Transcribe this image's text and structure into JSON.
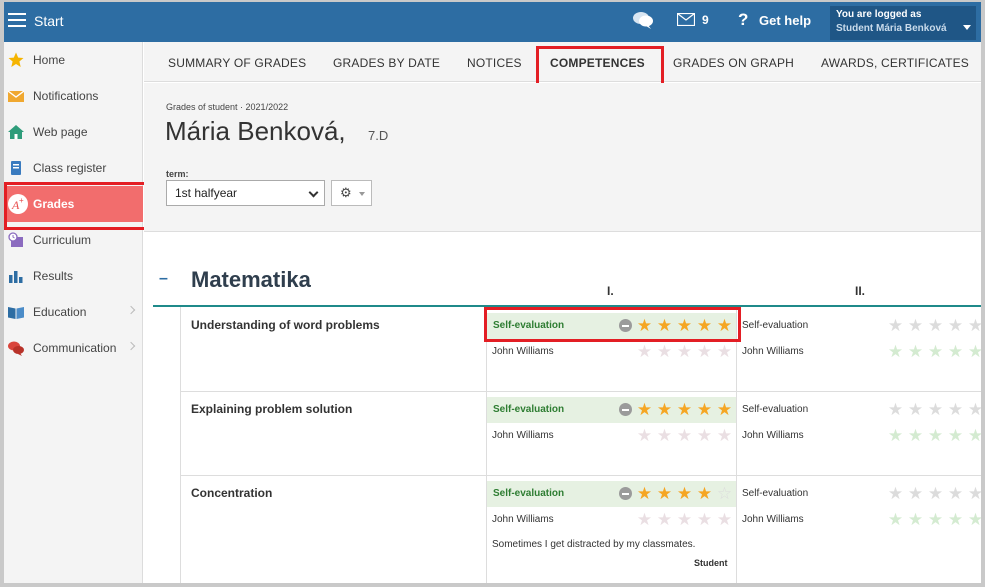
{
  "topbar": {
    "title": "Start",
    "menu_icon": "hamburger-icon",
    "chat_icon": "chat-bubbles-icon",
    "mail_icon": "mail-icon",
    "mail_count": "9",
    "help_icon": "question-icon",
    "help_label": "Get help",
    "logged_label": "You are logged as",
    "logged_user": "Student Mária Benková"
  },
  "sidebar": {
    "items": [
      {
        "label": "Home",
        "icon": "star-icon"
      },
      {
        "label": "Notifications",
        "icon": "envelope-icon"
      },
      {
        "label": "Web page",
        "icon": "house-icon"
      },
      {
        "label": "Class register",
        "icon": "book-icon"
      },
      {
        "label": "Grades",
        "icon": "grade-icon",
        "active": true
      },
      {
        "label": "Curriculum",
        "icon": "curriculum-icon"
      },
      {
        "label": "Results",
        "icon": "bar-chart-icon"
      },
      {
        "label": "Education",
        "icon": "open-book-icon"
      },
      {
        "label": "Communication",
        "icon": "speech-bubbles-icon"
      }
    ]
  },
  "tabs": [
    {
      "label": "SUMMARY OF GRADES"
    },
    {
      "label": "GRADES BY DATE"
    },
    {
      "label": "NOTICES"
    },
    {
      "label": "COMPETENCES",
      "active": true
    },
    {
      "label": "GRADES ON GRAPH"
    },
    {
      "label": "AWARDS, CERTIFICATES"
    }
  ],
  "header": {
    "grades_of": "Grades of student · 2021/2022",
    "student_name": "Mária Benková,",
    "student_class": "7.D",
    "term_label": "term:",
    "term_value": "1st halfyear"
  },
  "subject": {
    "collapse_symbol": "–",
    "name": "Matematika",
    "period_1": "I.",
    "period_2": "II."
  },
  "competences": [
    {
      "name": "Understanding of word problems",
      "self_label": "Self-evaluation",
      "self_stars_p1": 5,
      "teacher": "John Williams",
      "teacher_stars_p1": 0,
      "self_label_p2": "Self-evaluation",
      "teacher_p2": "John Williams"
    },
    {
      "name": "Explaining problem solution",
      "self_label": "Self-evaluation",
      "self_stars_p1": 5,
      "teacher": "John Williams",
      "teacher_stars_p1": 0,
      "self_label_p2": "Self-evaluation",
      "teacher_p2": "John Williams"
    },
    {
      "name": "Concentration",
      "self_label": "Self-evaluation",
      "self_stars_p1": 4,
      "teacher": "John Williams",
      "teacher_stars_p1": 0,
      "self_label_p2": "Self-evaluation",
      "teacher_p2": "John Williams",
      "note": "Sometimes I get distracted by my classmates.",
      "note_author": "Student"
    }
  ],
  "colors": {
    "topbar": "#2d6da3",
    "active_nav": "#f26d6d",
    "highlight": "#e31e24",
    "self_eval_bg": "#e6f1e2",
    "star_gold": "#f5a623"
  }
}
